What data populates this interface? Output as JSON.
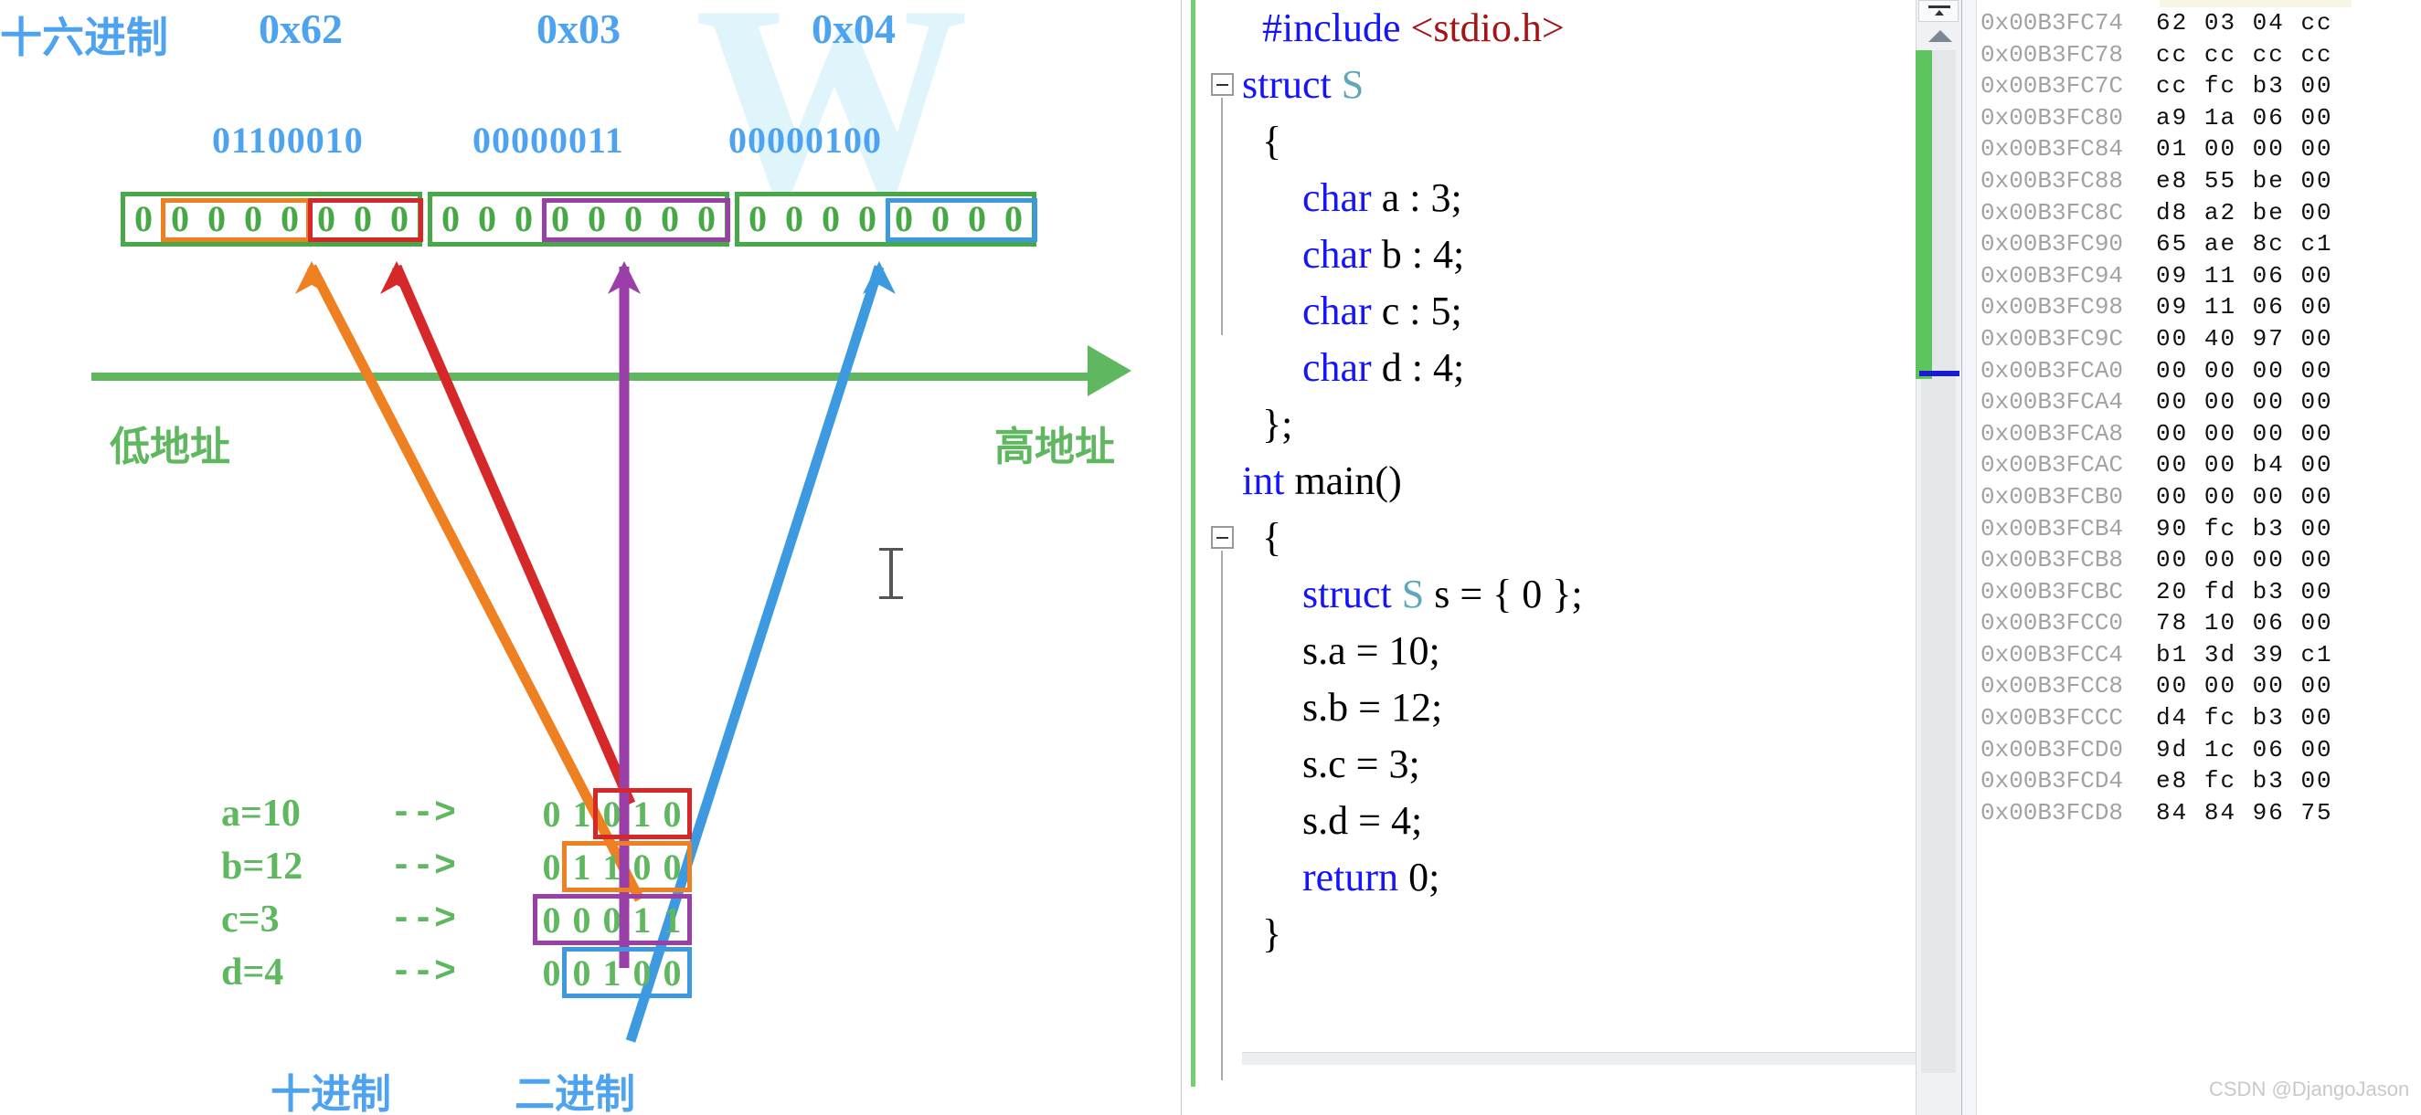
{
  "diagram": {
    "hex_row_label": "十六进制",
    "hex_values": [
      "0x62",
      "0x03",
      "0x04"
    ],
    "binary_values": [
      "01100010",
      "00000011",
      "00000100"
    ],
    "bytes": [
      {
        "bits": "00000000"
      },
      {
        "bits": "00000000"
      },
      {
        "bits": "00000000"
      }
    ],
    "axis": {
      "low_label": "低地址",
      "high_label": "高地址"
    },
    "values": [
      {
        "name": "a=10",
        "arrow": "-->",
        "bits": "01010",
        "color": "#d62828"
      },
      {
        "name": "b=12",
        "arrow": "-->",
        "bits": "01100",
        "color": "#ef8022"
      },
      {
        "name": "c=3",
        "arrow": "-->",
        "bits": "00011",
        "color": "#9b3fa8"
      },
      {
        "name": "d=4",
        "arrow": "-->",
        "bits": "00100",
        "color": "#3d9ae0"
      }
    ],
    "bottom_labels": {
      "decimal": "十进制",
      "binary": "二进制"
    },
    "watermark_letter": "W",
    "colors": {
      "byte_border": "#46a846",
      "axis": "#5fb85f",
      "blue_text": "#4da3ef",
      "green_text": "#5fb85f",
      "arrow_a": "#d62828",
      "arrow_b": "#ef8022",
      "arrow_c": "#9b3fa8",
      "arrow_d": "#3d9ae0"
    }
  },
  "editor": {
    "lines": [
      {
        "indent": 1,
        "tokens": [
          {
            "t": "#include ",
            "c": "pp"
          },
          {
            "t": "<stdio.h>",
            "c": "str"
          }
        ]
      },
      {
        "indent": 0,
        "tokens": [
          {
            "t": "struct ",
            "c": "kw"
          },
          {
            "t": "S",
            "c": "typ"
          }
        ]
      },
      {
        "indent": 1,
        "tokens": [
          {
            "t": "{",
            "c": ""
          }
        ]
      },
      {
        "indent": 3,
        "tokens": [
          {
            "t": "char",
            "c": "kw"
          },
          {
            "t": " a : 3;",
            "c": ""
          }
        ]
      },
      {
        "indent": 3,
        "tokens": [
          {
            "t": "char",
            "c": "kw"
          },
          {
            "t": " b : 4;",
            "c": ""
          }
        ]
      },
      {
        "indent": 3,
        "tokens": [
          {
            "t": "char",
            "c": "kw"
          },
          {
            "t": " c : 5;",
            "c": ""
          }
        ]
      },
      {
        "indent": 3,
        "tokens": [
          {
            "t": "char",
            "c": "kw"
          },
          {
            "t": " d : 4;",
            "c": ""
          }
        ]
      },
      {
        "indent": 1,
        "tokens": [
          {
            "t": "};",
            "c": ""
          }
        ]
      },
      {
        "indent": 0,
        "tokens": [
          {
            "t": "int",
            "c": "kw"
          },
          {
            "t": " main()",
            "c": ""
          }
        ]
      },
      {
        "indent": 1,
        "tokens": [
          {
            "t": "{",
            "c": ""
          }
        ]
      },
      {
        "indent": 3,
        "tokens": [
          {
            "t": "struct ",
            "c": "kw"
          },
          {
            "t": "S",
            "c": "typ"
          },
          {
            "t": " s = { 0 };",
            "c": ""
          }
        ]
      },
      {
        "indent": 3,
        "tokens": [
          {
            "t": "s.a = 10;",
            "c": ""
          }
        ]
      },
      {
        "indent": 3,
        "tokens": [
          {
            "t": "s.b = 12;",
            "c": ""
          }
        ]
      },
      {
        "indent": 3,
        "tokens": [
          {
            "t": "s.c = 3;",
            "c": ""
          }
        ]
      },
      {
        "indent": 3,
        "tokens": [
          {
            "t": "s.d = 4;",
            "c": ""
          }
        ]
      },
      {
        "indent": 3,
        "tokens": [
          {
            "t": "return",
            "c": "kw"
          },
          {
            "t": " 0;",
            "c": ""
          }
        ]
      },
      {
        "indent": 1,
        "tokens": [
          {
            "t": "}",
            "c": ""
          }
        ]
      }
    ]
  },
  "memory": {
    "rows": [
      {
        "address": "0x00B3FC74",
        "bytes": "62 03 04 cc"
      },
      {
        "address": "0x00B3FC78",
        "bytes": "cc cc cc cc"
      },
      {
        "address": "0x00B3FC7C",
        "bytes": "cc fc b3 00"
      },
      {
        "address": "0x00B3FC80",
        "bytes": "a9 1a 06 00"
      },
      {
        "address": "0x00B3FC84",
        "bytes": "01 00 00 00"
      },
      {
        "address": "0x00B3FC88",
        "bytes": "e8 55 be 00"
      },
      {
        "address": "0x00B3FC8C",
        "bytes": "d8 a2 be 00"
      },
      {
        "address": "0x00B3FC90",
        "bytes": "65 ae 8c c1"
      },
      {
        "address": "0x00B3FC94",
        "bytes": "09 11 06 00"
      },
      {
        "address": "0x00B3FC98",
        "bytes": "09 11 06 00"
      },
      {
        "address": "0x00B3FC9C",
        "bytes": "00 40 97 00"
      },
      {
        "address": "0x00B3FCA0",
        "bytes": "00 00 00 00"
      },
      {
        "address": "0x00B3FCA4",
        "bytes": "00 00 00 00"
      },
      {
        "address": "0x00B3FCA8",
        "bytes": "00 00 00 00"
      },
      {
        "address": "0x00B3FCAC",
        "bytes": "00 00 b4 00"
      },
      {
        "address": "0x00B3FCB0",
        "bytes": "00 00 00 00"
      },
      {
        "address": "0x00B3FCB4",
        "bytes": "90 fc b3 00"
      },
      {
        "address": "0x00B3FCB8",
        "bytes": "00 00 00 00"
      },
      {
        "address": "0x00B3FCBC",
        "bytes": "20 fd b3 00"
      },
      {
        "address": "0x00B3FCC0",
        "bytes": "78 10 06 00"
      },
      {
        "address": "0x00B3FCC4",
        "bytes": "b1 3d 39 c1"
      },
      {
        "address": "0x00B3FCC8",
        "bytes": "00 00 00 00"
      },
      {
        "address": "0x00B3FCCC",
        "bytes": "d4 fc b3 00"
      },
      {
        "address": "0x00B3FCD0",
        "bytes": "9d 1c 06 00"
      },
      {
        "address": "0x00B3FCD4",
        "bytes": "e8 fc b3 00"
      },
      {
        "address": "0x00B3FCD8",
        "bytes": "84 84 96 75"
      }
    ],
    "watermark": "CSDN @DjangoJason"
  }
}
